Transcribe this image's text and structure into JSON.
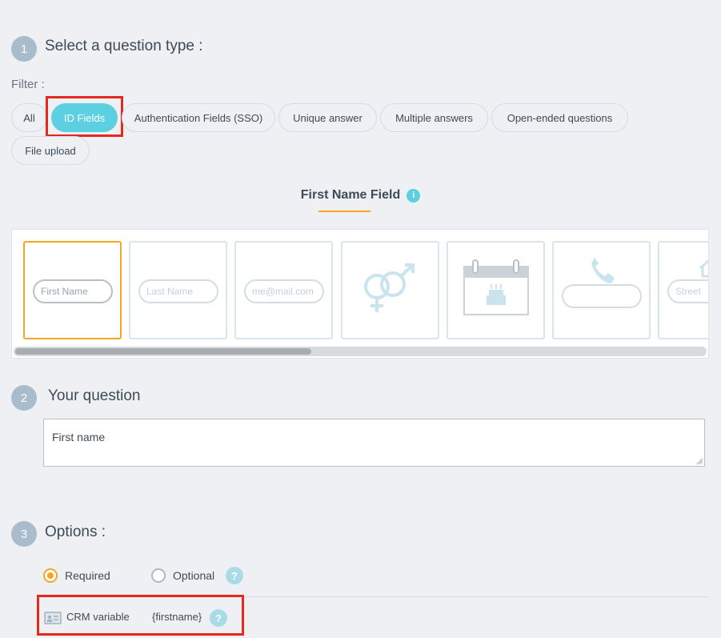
{
  "step1": {
    "number": "1",
    "title": "Select a question type :"
  },
  "filter": {
    "label": "Filter :",
    "chips": [
      "All",
      "ID Fields",
      "Authentication Fields (SSO)",
      "Unique answer",
      "Multiple answers",
      "Open-ended questions",
      "File upload"
    ],
    "active": "ID Fields"
  },
  "field_section": {
    "title": "First Name Field",
    "info_symbol": "i"
  },
  "cards": {
    "first_name_placeholder": "First Name",
    "last_name_placeholder": "Last Name",
    "email_placeholder": "me@mail.com",
    "street_placeholder": "Street"
  },
  "step2": {
    "number": "2",
    "title": "Your question"
  },
  "question": {
    "value": "First name"
  },
  "step3": {
    "number": "3",
    "title": "Options :"
  },
  "options": {
    "required_label": "Required",
    "optional_label": "Optional",
    "selected": "Required",
    "help_symbol": "?"
  },
  "crm": {
    "label": "CRM variable",
    "value": "{firstname}",
    "help_symbol": "?"
  },
  "colors": {
    "accent": "#5ccfe0",
    "selected_border": "#f5a623",
    "highlight": "#e5281d",
    "step_circle": "#a8bccb"
  }
}
